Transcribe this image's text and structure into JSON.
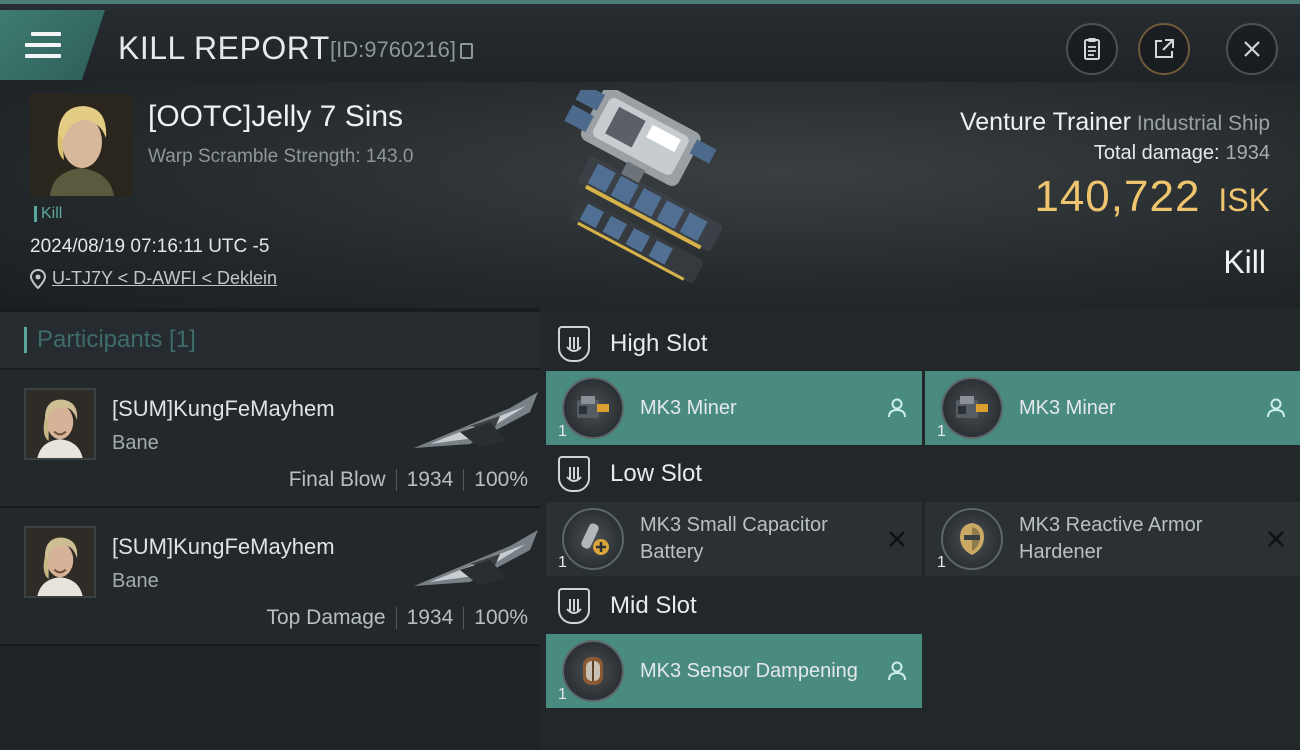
{
  "header": {
    "title": "KILL REPORT",
    "report_id": "[ID:9760216]"
  },
  "victim": {
    "name": "[OOTC]Jelly 7 Sins",
    "warp_scramble": "Warp Scramble Strength: 143.0",
    "tag": "Kill",
    "timestamp": "2024/08/19 07:16:11 UTC -5",
    "location": "U-TJ7Y < D-AWFI < Deklein",
    "ship_name": "Venture Trainer",
    "ship_class": "Industrial Ship",
    "total_damage_label": "Total damage:",
    "total_damage": "1934",
    "isk_value": "140,722",
    "isk_unit": "ISK",
    "result": "Kill"
  },
  "participants": {
    "heading": "Participants [1]",
    "items": [
      {
        "name": "[SUM]KungFeMayhem",
        "ship": "Bane",
        "role": "Final Blow",
        "damage": "1934",
        "percent": "100%"
      },
      {
        "name": "[SUM]KungFeMayhem",
        "ship": "Bane",
        "role": "Top Damage",
        "damage": "1934",
        "percent": "100%"
      }
    ]
  },
  "slots": {
    "high": {
      "label": "High Slot",
      "modules": [
        {
          "name": "MK3 Miner",
          "qty": "1",
          "status": "fitted"
        },
        {
          "name": "MK3 Miner",
          "qty": "1",
          "status": "fitted"
        }
      ]
    },
    "low": {
      "label": "Low Slot",
      "modules": [
        {
          "name": "MK3 Small Capacitor Battery",
          "qty": "1",
          "status": "destroyed"
        },
        {
          "name": "MK3 Reactive Armor Hardener",
          "qty": "1",
          "status": "destroyed"
        }
      ]
    },
    "mid": {
      "label": "Mid Slot",
      "modules": [
        {
          "name": "MK3 Sensor Dampening",
          "qty": "1",
          "status": "fitted"
        }
      ]
    }
  },
  "colors": {
    "accent": "#4a8b80",
    "isk": "#efc46f",
    "teal_text": "#5aa89c"
  },
  "icons": [
    "menu-icon",
    "copy-icon",
    "clipboard-icon",
    "share-icon",
    "close-icon",
    "location-pin-icon",
    "shield-icon",
    "pilot-icon",
    "destroyed-x-icon"
  ]
}
